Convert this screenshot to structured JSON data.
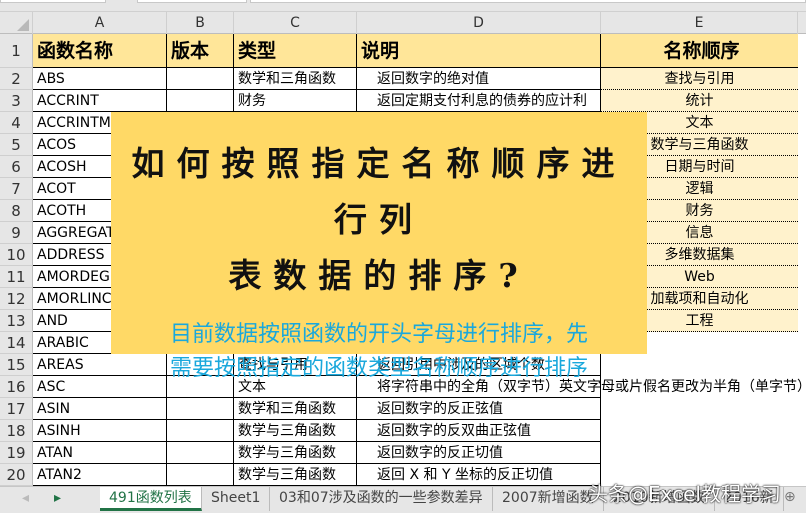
{
  "columns": [
    "A",
    "B",
    "C",
    "D",
    "E"
  ],
  "header": {
    "A": "函数名称",
    "B": "版本",
    "C": "类型",
    "D": "说明",
    "E": "名称顺序"
  },
  "rows": [
    {
      "n": "2",
      "a": "ABS",
      "c": "数学和三角函数",
      "d": "返回数字的绝对值",
      "e": "查找与引用"
    },
    {
      "n": "3",
      "a": "ACCRINT",
      "c": "财务",
      "d": "返回定期支付利息的债券的应计利",
      "e": "统计"
    },
    {
      "n": "4",
      "a": "ACCRINTM",
      "c": "",
      "d": "",
      "e": "文本"
    },
    {
      "n": "5",
      "a": "ACOS",
      "c": "",
      "d": "",
      "e": "数学与三角函数"
    },
    {
      "n": "6",
      "a": "ACOSH",
      "c": "",
      "d": "",
      "e": "日期与时间"
    },
    {
      "n": "7",
      "a": "ACOT",
      "c": "",
      "d": "",
      "e": "逻辑"
    },
    {
      "n": "8",
      "a": "ACOTH",
      "c": "",
      "d": "",
      "e": "财务"
    },
    {
      "n": "9",
      "a": "AGGREGATE",
      "c": "",
      "d": "",
      "e": "信息"
    },
    {
      "n": "10",
      "a": "ADDRESS",
      "c": "",
      "d": "",
      "e": "多维数据集"
    },
    {
      "n": "11",
      "a": "AMORDEGRC",
      "c": "",
      "d": "",
      "e": "Web"
    },
    {
      "n": "12",
      "a": "AMORLINC",
      "c": "",
      "d": "",
      "e": "加载项和自动化"
    },
    {
      "n": "13",
      "a": "AND",
      "c": "",
      "d": "",
      "e": "工程"
    },
    {
      "n": "14",
      "a": "ARABIC",
      "c": "",
      "d": "",
      "e": ""
    },
    {
      "n": "15",
      "a": "AREAS",
      "c": "查找与引用",
      "d": "返回引用中涉及的区域个数",
      "e": ""
    },
    {
      "n": "16",
      "a": "ASC",
      "c": "文本",
      "d": "将字符串中的全角（双字节）英文字母或片假名更改为半角（单字节）",
      "e": ""
    },
    {
      "n": "17",
      "a": "ASIN",
      "c": "数学和三角函数",
      "d": "返回数字的反正弦值",
      "e": ""
    },
    {
      "n": "18",
      "a": "ASINH",
      "c": "数学与三角函数",
      "d": "返回数字的反双曲正弦值",
      "e": ""
    },
    {
      "n": "19",
      "a": "ATAN",
      "c": "数学与三角函数",
      "d": "返回数字的反正切值",
      "e": ""
    },
    {
      "n": "20",
      "a": "ATAN2",
      "c": "数学与三角函数",
      "d": "返回 X 和 Y 坐标的反正切值",
      "e": ""
    }
  ],
  "overlay": {
    "title_line1": "如何按照指定名称顺序进行列",
    "title_line2": "表数据的排序?",
    "subtitle_line1": "目前数据按照函数的开头字母进行排序，先",
    "subtitle_line2": "需要按照指定的函数类型名称顺序进行排序",
    "bg": "#ffd966",
    "subtitle_color": "#1aa8dc"
  },
  "tabs": [
    "491函数列表",
    "Sheet1",
    "03和07涉及函数的一些参数差异",
    "2007新增函数",
    "2010新增函数",
    "2016新"
  ],
  "active_tab": "491函数列表",
  "watermark": "头条@Excel教程学习"
}
